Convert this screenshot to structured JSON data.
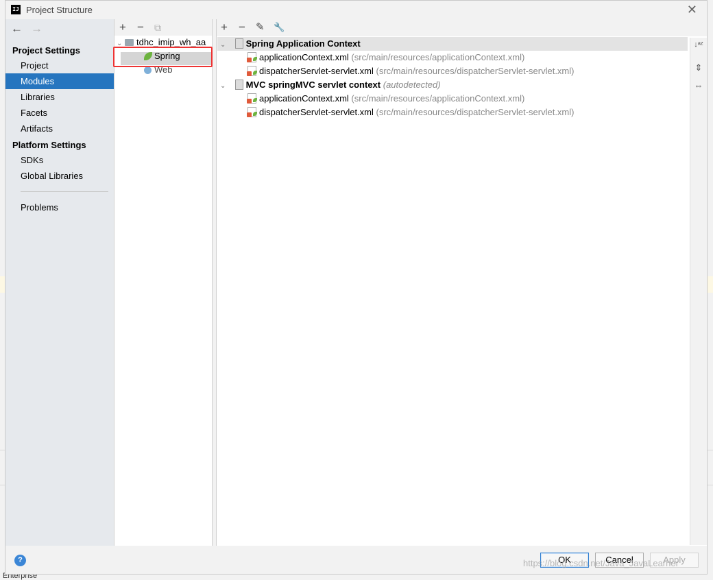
{
  "window": {
    "title": "Project Structure",
    "app_icon": "IJ"
  },
  "nav": {
    "back": "←",
    "forward": "→"
  },
  "sidebar": {
    "project_settings_header": "Project Settings",
    "platform_settings_header": "Platform Settings",
    "project_items": [
      "Project",
      "Modules",
      "Libraries",
      "Facets",
      "Artifacts"
    ],
    "platform_items": [
      "SDKs",
      "Global Libraries"
    ],
    "problems": "Problems",
    "selected": "Modules"
  },
  "module_tree": {
    "toolbar": {
      "add": "+",
      "remove": "−",
      "copy": "⧉"
    },
    "module": "tdhc_imip_wh_aa",
    "facets": [
      "Spring",
      "Web"
    ]
  },
  "contexts_toolbar": {
    "add": "+",
    "remove": "−",
    "edit": "✎",
    "settings": "🔧"
  },
  "contexts": [
    {
      "name": "Spring Application Context",
      "note": "",
      "files": [
        {
          "name": "applicationContext.xml",
          "path": "(src/main/resources/applicationContext.xml)"
        },
        {
          "name": "dispatcherServlet-servlet.xml",
          "path": "(src/main/resources/dispatcherServlet-servlet.xml)"
        }
      ]
    },
    {
      "name": "MVC springMVC servlet context",
      "note": "(autodetected)",
      "files": [
        {
          "name": "applicationContext.xml",
          "path": "(src/main/resources/applicationContext.xml)"
        },
        {
          "name": "dispatcherServlet-servlet.xml",
          "path": "(src/main/resources/dispatcherServlet-servlet.xml)"
        }
      ]
    }
  ],
  "side_tools": {
    "sort": "↓ᵃᶻ",
    "expand": "⇕",
    "collapse": "⇔"
  },
  "buttons": {
    "help": "?",
    "ok": "OK",
    "cancel": "Cancel",
    "apply": "Apply"
  },
  "watermark": "https://blog.csdn.net/Java_JavaLearner",
  "bottom_text": "Enterprise",
  "colors": {
    "selection": "#2675bf",
    "highlight_box": "#e33333",
    "spring_green": "#6db33f"
  }
}
